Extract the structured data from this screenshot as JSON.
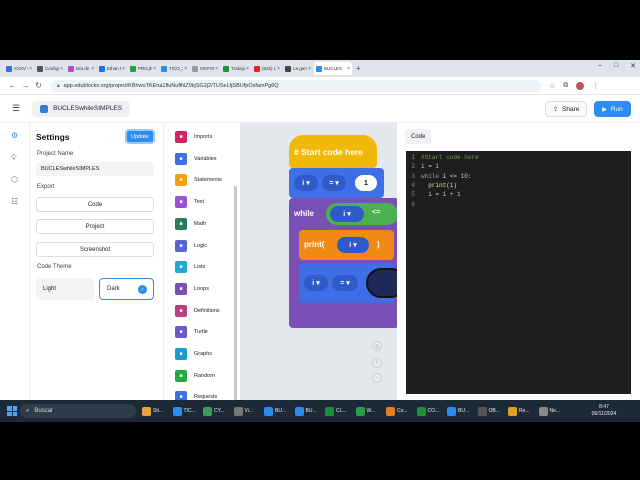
{
  "browser": {
    "tabs": [
      {
        "label": "XXXV C",
        "color": "#3b6fd6"
      },
      {
        "label": "Configu",
        "color": "#555555"
      },
      {
        "label": "Día de",
        "color": "#c048c8"
      },
      {
        "label": "Ethan M",
        "color": "#1a73e8"
      },
      {
        "label": "PRG.jhi",
        "color": "#2a9d4b"
      },
      {
        "label": "TICO_20",
        "color": "#2d8cf0"
      },
      {
        "label": "OKPOO",
        "color": "#999999"
      },
      {
        "label": "Trabajo",
        "color": "#1f8f3a"
      },
      {
        "label": "(625) U",
        "color": "#e0242c"
      },
      {
        "label": "La gene",
        "color": "#444444"
      },
      {
        "label": "BUCLES",
        "color": "#2d8cf0",
        "active": true
      }
    ],
    "url": "app.edublocks.org/project/KBhwuTKEna1fluNuflhlZ9kjSG2j2/TUSeLfjSBUfpOsfamPg6Q"
  },
  "header": {
    "project_name": "BUCLESwhileSIMPLES",
    "share_label": "Share",
    "run_label": "Run"
  },
  "settings": {
    "title": "Settings",
    "update_label": "Update",
    "project_name_label": "Project Name",
    "project_name_value": "BUCLESwhileSIMPLES",
    "export_label": "Export",
    "export_code": "Code",
    "export_project": "Project",
    "export_screenshot": "Screenshot",
    "theme_label": "Code Theme",
    "theme_light": "Light",
    "theme_dark": "Dark",
    "theme_selected": "Dark"
  },
  "palette": [
    {
      "label": "Imports",
      "color": "#d0245c",
      "icon": "import-icon"
    },
    {
      "label": "Variables",
      "color": "#3e6fe6",
      "icon": "variables-icon"
    },
    {
      "label": "Statements",
      "color": "#f0a010",
      "icon": "statements-icon"
    },
    {
      "label": "Text",
      "color": "#9c4fd6",
      "icon": "text-icon"
    },
    {
      "label": "Math",
      "color": "#2a7d54",
      "icon": "math-icon"
    },
    {
      "label": "Logic",
      "color": "#5a63d6",
      "icon": "logic-icon"
    },
    {
      "label": "Lists",
      "color": "#1fa8d6",
      "icon": "lists-icon"
    },
    {
      "label": "Loops",
      "color": "#7a4fb6",
      "icon": "loops-icon"
    },
    {
      "label": "Definitions",
      "color": "#b9407a",
      "icon": "definitions-icon"
    },
    {
      "label": "Turtle",
      "color": "#6b5bc8",
      "icon": "turtle-icon"
    },
    {
      "label": "Graphs",
      "color": "#1a9cd0",
      "icon": "graphs-icon"
    },
    {
      "label": "Random",
      "color": "#28a745",
      "icon": "random-icon"
    },
    {
      "label": "Requests",
      "color": "#3e6fe6",
      "icon": "requests-icon"
    }
  ],
  "blocks": {
    "hat": "# Start code here",
    "var_i": "i",
    "eq": "=",
    "one": "1",
    "while_kw": "while",
    "le": "<=",
    "print_kw": "print(",
    "print_close": ")"
  },
  "code": {
    "tab": "Code",
    "lines": [
      {
        "n": "1",
        "parts": [
          {
            "t": "#Start code here",
            "c": "comment"
          }
        ]
      },
      {
        "n": "2",
        "parts": [
          {
            "t": "i",
            "c": "id"
          },
          {
            "t": " = ",
            "c": "op"
          },
          {
            "t": "1",
            "c": "num"
          }
        ]
      },
      {
        "n": "3",
        "parts": [
          {
            "t": "while",
            "c": "kw"
          },
          {
            "t": " i <= ",
            "c": "op"
          },
          {
            "t": "10",
            "c": "num"
          },
          {
            "t": ":",
            "c": "op"
          }
        ]
      },
      {
        "n": "4",
        "parts": [
          {
            "t": "  ",
            "c": "op"
          },
          {
            "t": "print",
            "c": "fn"
          },
          {
            "t": "(i)",
            "c": "op"
          }
        ]
      },
      {
        "n": "5",
        "parts": [
          {
            "t": "  i = i + ",
            "c": "op"
          },
          {
            "t": "1",
            "c": "num"
          }
        ]
      },
      {
        "n": "6",
        "parts": []
      }
    ]
  },
  "taskbar": {
    "search_placeholder": "Buscar",
    "apps": [
      "Sti...",
      "TIC...",
      "CY...",
      "Vi...",
      "BU...",
      "BU...",
      "CL...",
      "W...",
      "Co...",
      "CO...",
      "BU...",
      "OB...",
      "Re...",
      "Ne..."
    ],
    "time": "8:47",
    "date": "06/11/2024"
  }
}
